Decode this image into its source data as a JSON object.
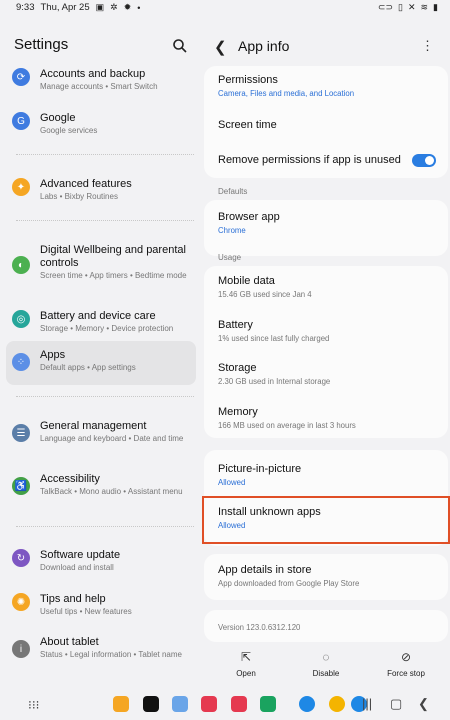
{
  "status": {
    "time": "9:33",
    "date": "Thu, Apr 25",
    "left_icons": [
      "image-icon",
      "settings-icon",
      "brightness-icon",
      "dot"
    ],
    "right_icons": [
      "link-icon",
      "battery-saver-icon",
      "mute-icon",
      "wifi-icon",
      "battery-icon"
    ]
  },
  "settings": {
    "title": "Settings",
    "items": [
      {
        "title": "Accounts and backup",
        "subtitle": "Manage accounts  •  Smart Switch",
        "color": "#3f7be0",
        "icon": "sync-icon"
      },
      {
        "title": "Google",
        "subtitle": "Google services",
        "color": "#3f7be0",
        "icon": "google-icon"
      },
      {
        "title": "Advanced features",
        "subtitle": "Labs  •  Bixby Routines",
        "color": "#f5a623",
        "icon": "star-gear-icon"
      },
      {
        "title": "Digital Wellbeing and parental controls",
        "subtitle": "Screen time  •  App timers  •  Bedtime mode",
        "color": "#4cb050",
        "icon": "wellbeing-icon"
      },
      {
        "title": "Battery and device care",
        "subtitle": "Storage  •  Memory  •  Device protection",
        "color": "#26a69a",
        "icon": "device-care-icon"
      },
      {
        "title": "Apps",
        "subtitle": "Default apps  •  App settings",
        "color": "#5c8fe6",
        "icon": "apps-icon"
      },
      {
        "title": "General management",
        "subtitle": "Language and keyboard  •  Date and time",
        "color": "#5b7ea8",
        "icon": "sliders-icon"
      },
      {
        "title": "Accessibility",
        "subtitle": "TalkBack  •  Mono audio  •  Assistant menu",
        "color": "#43a047",
        "icon": "accessibility-icon"
      },
      {
        "title": "Software update",
        "subtitle": "Download and install",
        "color": "#7e57c2",
        "icon": "update-icon"
      },
      {
        "title": "Tips and help",
        "subtitle": "Useful tips  •  New features",
        "color": "#f5a623",
        "icon": "bulb-icon"
      },
      {
        "title": "About tablet",
        "subtitle": "Status  •  Legal information  •  Tablet name",
        "color": "#777777",
        "icon": "info-icon"
      }
    ]
  },
  "app_info": {
    "title": "App info",
    "permissions": {
      "title": "Permissions",
      "subtitle": "Camera, Files and media, and Location"
    },
    "screen_time": {
      "title": "Screen time"
    },
    "remove_permissions": {
      "title": "Remove permissions if app is unused",
      "enabled": true
    },
    "defaults_label": "Defaults",
    "browser_app": {
      "title": "Browser app",
      "subtitle": "Chrome"
    },
    "usage_label": "Usage",
    "mobile_data": {
      "title": "Mobile data",
      "subtitle": "15.46 GB used since Jan 4"
    },
    "battery": {
      "title": "Battery",
      "subtitle": "1% used since last fully charged"
    },
    "storage": {
      "title": "Storage",
      "subtitle": "2.30 GB used in Internal storage"
    },
    "memory": {
      "title": "Memory",
      "subtitle": "166 MB used on average in last 3 hours"
    },
    "pip": {
      "title": "Picture-in-picture",
      "subtitle": "Allowed"
    },
    "install_unknown": {
      "title": "Install unknown apps",
      "subtitle": "Allowed"
    },
    "app_details": {
      "title": "App details in store",
      "subtitle": "App downloaded from Google Play Store"
    },
    "version": "Version 123.0.6312.120",
    "actions": {
      "open": "Open",
      "disable": "Disable",
      "force_stop": "Force stop"
    }
  },
  "highlight_color": "#e04f26",
  "accent_color": "#2a6fd6"
}
